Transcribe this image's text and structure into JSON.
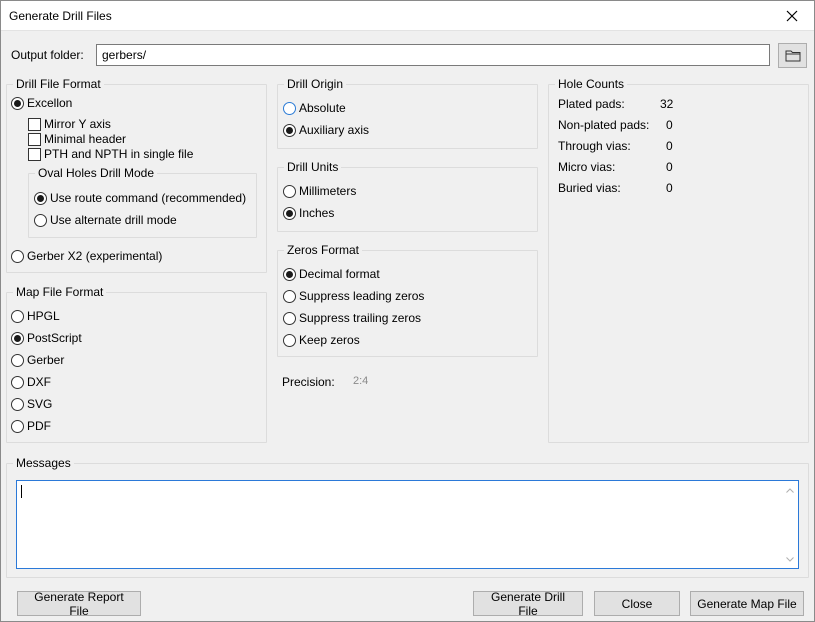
{
  "window": {
    "title": "Generate Drill Files"
  },
  "output": {
    "label": "Output folder:",
    "value": "gerbers/"
  },
  "drill_file_format": {
    "title": "Drill File Format",
    "excellon": "Excellon",
    "mirror_y": "Mirror Y axis",
    "minimal_header": "Minimal header",
    "pth_npth_single": "PTH and NPTH in single file",
    "oval_holes": {
      "title": "Oval Holes Drill Mode",
      "route": "Use route command (recommended)",
      "alternate": "Use alternate drill mode"
    },
    "gerber_x2": "Gerber X2 (experimental)"
  },
  "map_file_format": {
    "title": "Map File Format",
    "options": [
      "HPGL",
      "PostScript",
      "Gerber",
      "DXF",
      "SVG",
      "PDF"
    ],
    "selected": "PostScript"
  },
  "drill_origin": {
    "title": "Drill Origin",
    "absolute": "Absolute",
    "auxiliary": "Auxiliary axis"
  },
  "drill_units": {
    "title": "Drill Units",
    "millimeters": "Millimeters",
    "inches": "Inches"
  },
  "zeros_format": {
    "title": "Zeros Format",
    "decimal": "Decimal format",
    "suppress_leading": "Suppress leading zeros",
    "suppress_trailing": "Suppress trailing zeros",
    "keep": "Keep zeros"
  },
  "precision": {
    "label": "Precision:",
    "value": "2:4"
  },
  "hole_counts": {
    "title": "Hole Counts",
    "plated_label": "Plated pads:",
    "plated_value": "32",
    "nonplated_label": "Non-plated pads:",
    "nonplated_value": "0",
    "through_label": "Through vias:",
    "through_value": "0",
    "micro_label": "Micro vias:",
    "micro_value": "0",
    "buried_label": "Buried vias:",
    "buried_value": "0"
  },
  "messages": {
    "title": "Messages",
    "value": ""
  },
  "buttons": {
    "report": "Generate Report File",
    "drill": "Generate Drill File",
    "close": "Close",
    "map": "Generate Map File"
  },
  "colors": {
    "accent": "#2b79d8",
    "background": "#f0f0f0",
    "disabled_text": "#8a8a8a"
  },
  "icons": {
    "close": "close-icon",
    "folder": "folder-icon"
  }
}
